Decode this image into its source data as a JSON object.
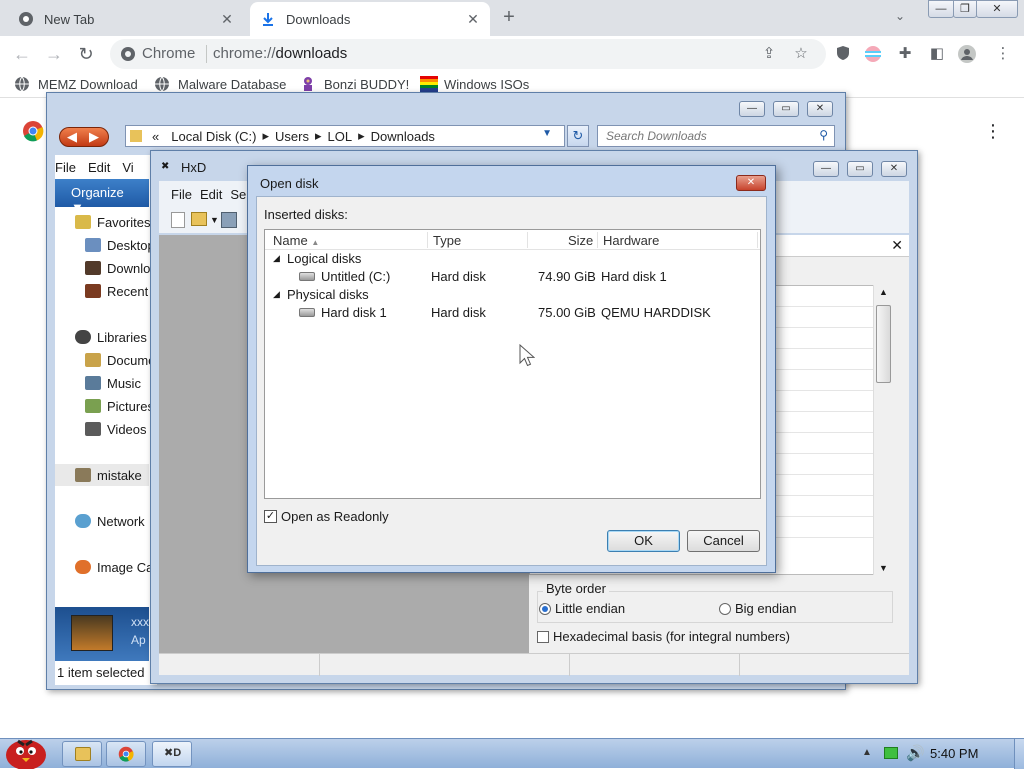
{
  "browser": {
    "tabs": [
      {
        "label": "New Tab",
        "icon": "chrome-icon",
        "active": false
      },
      {
        "label": "Downloads",
        "icon": "download-icon",
        "active": true
      }
    ],
    "new_tab_label": "+",
    "omnibox": {
      "site": "Chrome",
      "scheme": "chrome://",
      "host": "downloads"
    },
    "bookmarks": [
      {
        "label": "MEMZ Download",
        "icon": "globe-icon"
      },
      {
        "label": "Malware Database",
        "icon": "globe-icon"
      },
      {
        "label": "Bonzi BUDDY!",
        "icon": "bonzi-icon"
      },
      {
        "label": "Windows ISOs",
        "icon": "windows-icon"
      }
    ]
  },
  "explorer": {
    "address": [
      "Local Disk (C:)",
      "Users",
      "LOL",
      "Downloads"
    ],
    "search_placeholder": "Search Downloads",
    "menu": [
      "File",
      "Edit",
      "Vi"
    ],
    "organize": "Organize ▼",
    "nav": [
      {
        "label": "Favorites",
        "group": true
      },
      {
        "label": "Desktop",
        "group": false
      },
      {
        "label": "Downlo",
        "group": false
      },
      {
        "label": "Recent",
        "group": false
      },
      {
        "label": "Libraries",
        "group": true
      },
      {
        "label": "Docume",
        "group": false
      },
      {
        "label": "Music",
        "group": false
      },
      {
        "label": "Pictures",
        "group": false
      },
      {
        "label": "Videos",
        "group": false
      },
      {
        "label": "mistake",
        "group": true
      },
      {
        "label": "Network",
        "group": true
      },
      {
        "label": "Image Ca",
        "group": true
      }
    ],
    "details_text": [
      "xxx",
      "Ap"
    ],
    "status": "1 item selected"
  },
  "hxd": {
    "title": "HxD",
    "menu": [
      "File",
      "Edit",
      "Se"
    ],
    "byte_order_label": "Byte order",
    "little_endian": "Little endian",
    "big_endian": "Big endian",
    "hex_basis": "Hexadecimal basis (for integral numbers)"
  },
  "dialog": {
    "title": "Open disk",
    "inserted_label": "Inserted disks:",
    "columns": {
      "name": "Name",
      "type": "Type",
      "size": "Size",
      "hardware": "Hardware"
    },
    "groups": [
      {
        "label": "Logical disks",
        "rows": [
          {
            "name": "Untitled (C:)",
            "type": "Hard disk",
            "size": "74.90 GiB",
            "hardware": "Hard disk 1"
          }
        ]
      },
      {
        "label": "Physical disks",
        "rows": [
          {
            "name": "Hard disk 1",
            "type": "Hard disk",
            "size": "75.00 GiB",
            "hardware": "QEMU HARDDISK"
          }
        ]
      }
    ],
    "readonly_label": "Open as Readonly",
    "ok_label": "OK",
    "cancel_label": "Cancel"
  },
  "taskbar": {
    "time": "5:40 PM"
  },
  "colors": {
    "accent": "#1f5aa6",
    "close": "#c7432c"
  }
}
